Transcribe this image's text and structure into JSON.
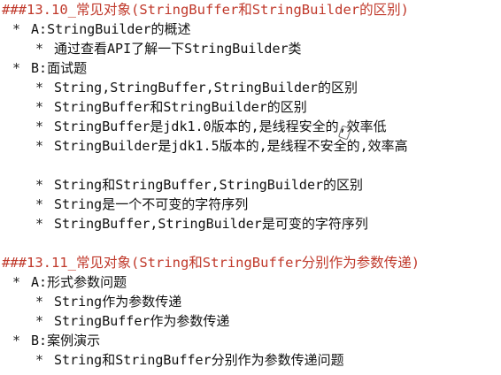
{
  "sections": [
    {
      "title": "###13.10_常见对象(StringBuffer和StringBuilder的区别)",
      "items": [
        {
          "label": "A:StringBuilder的概述",
          "subitems": [
            "通过查看API了解一下StringBuilder类"
          ]
        },
        {
          "label": "B:面试题",
          "subitems": [
            "String,StringBuffer,StringBuilder的区别",
            "StringBuffer和StringBuilder的区别",
            "StringBuffer是jdk1.0版本的,是线程安全的,效率低",
            "StringBuilder是jdk1.5版本的,是线程不安全的,效率高",
            "",
            "String和StringBuffer,StringBuilder的区别",
            "String是一个不可变的字符序列",
            "StringBuffer,StringBuilder是可变的字符序列"
          ]
        }
      ]
    },
    {
      "title": "###13.11_常见对象(String和StringBuffer分别作为参数传递)",
      "items": [
        {
          "label": "A:形式参数问题",
          "subitems": [
            "String作为参数传递",
            "StringBuffer作为参数传递"
          ]
        },
        {
          "label": "B:案例演示",
          "subitems": [
            "String和StringBuffer分别作为参数传递问题"
          ]
        }
      ]
    }
  ],
  "bullet": "*",
  "colors": {
    "heading": "#c0392b",
    "text": "#111111",
    "background": "#ffffff"
  }
}
